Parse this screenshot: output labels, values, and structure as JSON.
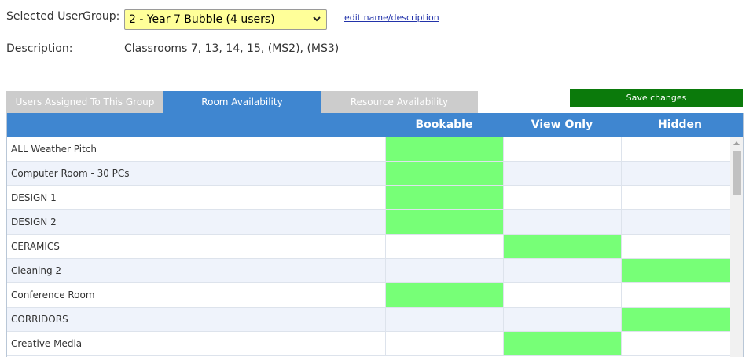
{
  "header": {
    "usergroup_label": "Selected UserGroup:",
    "usergroup_value": "2 - Year 7 Bubble (4 users)",
    "edit_link": "edit name/description",
    "description_label": "Description:",
    "description_value": "Classrooms 7, 13, 14, 15, (MS2), (MS3)"
  },
  "tabs": [
    {
      "label": "Users Assigned To This Group",
      "active": false
    },
    {
      "label": "Room Availability",
      "active": true
    },
    {
      "label": "Resource Availability",
      "active": false
    }
  ],
  "save_button": "Save changes",
  "columns": [
    "Bookable",
    "View Only",
    "Hidden"
  ],
  "rows": [
    {
      "name": "ALL Weather Pitch",
      "selected": 0
    },
    {
      "name": "Computer Room - 30 PCs",
      "selected": 0
    },
    {
      "name": "DESIGN 1",
      "selected": 0
    },
    {
      "name": "DESIGN 2",
      "selected": 0
    },
    {
      "name": "CERAMICS",
      "selected": 1
    },
    {
      "name": "Cleaning 2",
      "selected": 2
    },
    {
      "name": "Conference Room",
      "selected": 0
    },
    {
      "name": "CORRIDORS",
      "selected": 2
    },
    {
      "name": "Creative Media",
      "selected": 1
    }
  ],
  "colors": {
    "selected_cell": "#77ff77",
    "tab_active": "#3f86d0",
    "tab_inactive": "#cccccc",
    "save_button": "#0b7a0b",
    "select_bg": "#ffff99"
  },
  "icons": {
    "dropdown": "chevron-down-icon",
    "scroll_up": "arrow-up-icon"
  }
}
